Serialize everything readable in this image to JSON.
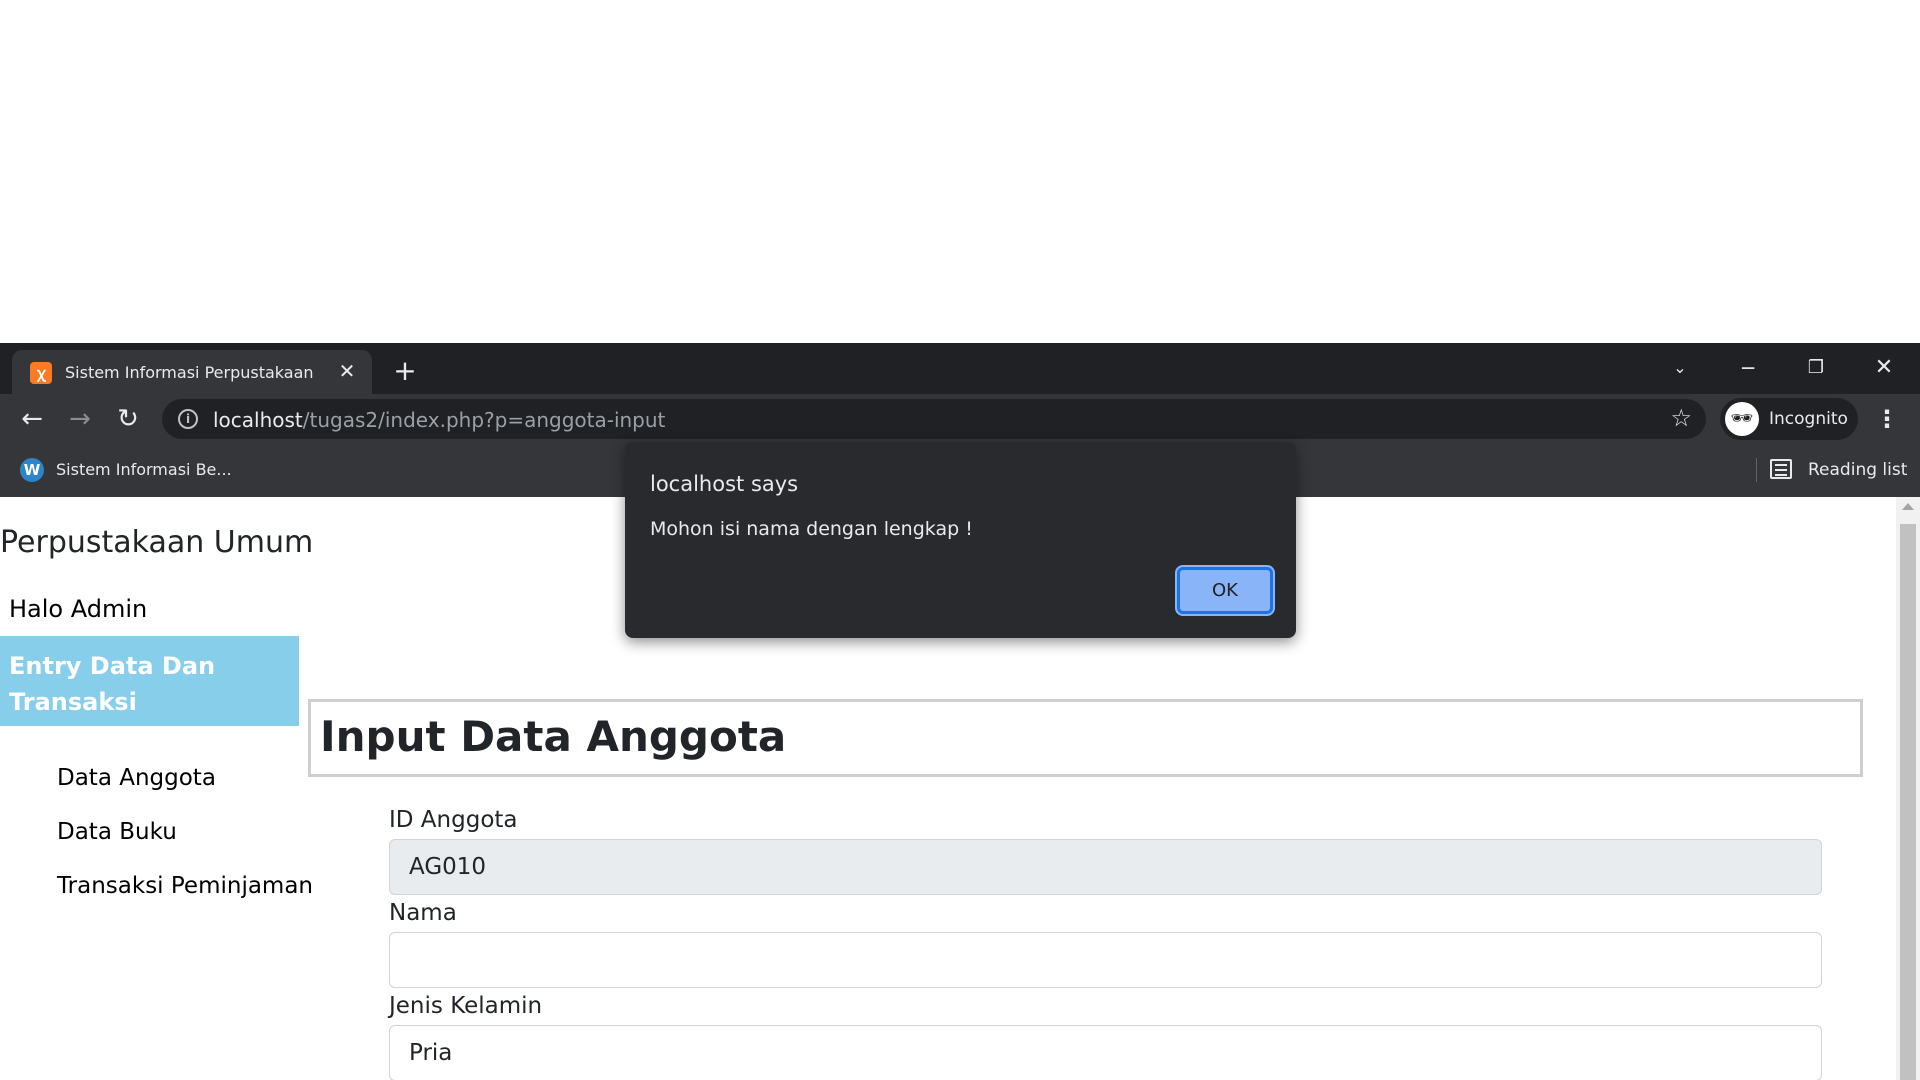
{
  "browser": {
    "tab": {
      "title": "Sistem Informasi Perpustakaan",
      "favicon_icon": "xampp-icon",
      "close_glyph": "✕"
    },
    "new_tab_glyph": "+",
    "window_controls": {
      "tab_search_glyph": "⌄",
      "minimize_glyph": "─",
      "restore_glyph": "❐",
      "close_glyph": "✕"
    },
    "nav": {
      "back_glyph": "←",
      "forward_glyph": "→",
      "reload_glyph": "↻"
    },
    "address": {
      "host": "localhost",
      "path": "/tugas2/index.php?p=anggota-input"
    },
    "profile_label": "Incognito",
    "bookmarks": [
      {
        "label": "Sistem Informasi Be...",
        "icon": "wordpress-icon"
      }
    ],
    "reading_list_label": "Reading list"
  },
  "page": {
    "brand": "Perpustakaan Umum",
    "sidebar": {
      "greeting": "Halo Admin",
      "active_item": "Entry Data Dan Transaksi",
      "sub_items": [
        "Data Anggota",
        "Data Buku",
        "Transaksi Peminjaman"
      ]
    },
    "heading": "Input Data Anggota",
    "form": {
      "id_label": "ID Anggota",
      "id_value": "AG010",
      "nama_label": "Nama",
      "nama_value": "",
      "jenis_kelamin_label": "Jenis Kelamin",
      "jenis_kelamin_value": "Pria"
    }
  },
  "dialog": {
    "title": "localhost says",
    "message": "Mohon isi nama dengan lengkap !",
    "ok_label": "OK"
  },
  "colors": {
    "chrome_dark": "#202124",
    "chrome_toolbar": "#35363a",
    "sidebar_active": "#87ceeb",
    "dialog_bg": "#292a2d",
    "ok_button": "#8ab4f8"
  }
}
